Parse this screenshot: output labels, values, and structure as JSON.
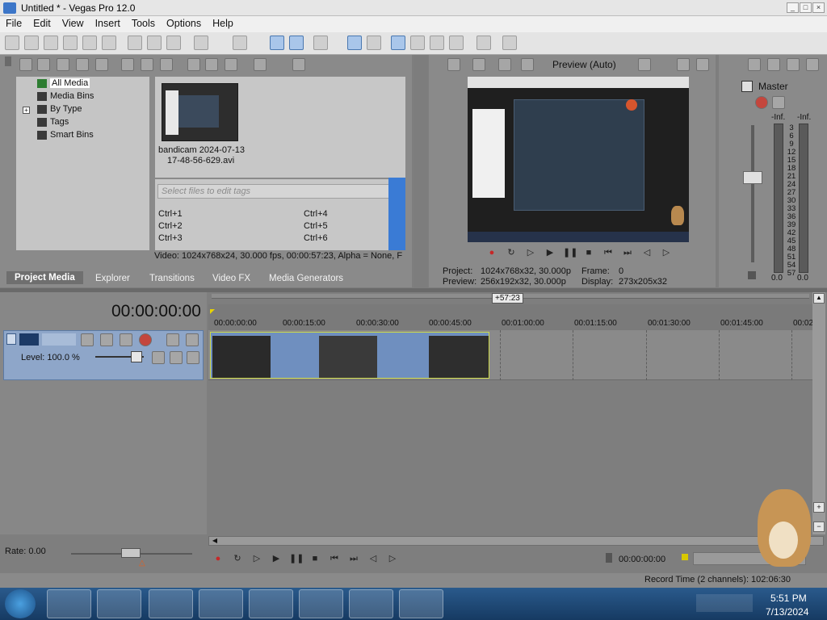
{
  "window": {
    "title": "Untitled * - Vegas Pro 12.0"
  },
  "menu": [
    "File",
    "Edit",
    "View",
    "Insert",
    "Tools",
    "Options",
    "Help"
  ],
  "explorer": {
    "tree": [
      "All Media",
      "Media Bins",
      "By Type",
      "Tags",
      "Smart Bins"
    ],
    "media_file": {
      "name_line1": "bandicam 2024-07-13",
      "name_line2": "17-48-56-629.avi"
    },
    "tags_placeholder": "Select files to edit tags",
    "shortcuts": [
      "Ctrl+1",
      "Ctrl+2",
      "Ctrl+3",
      "Ctrl+4",
      "Ctrl+5",
      "Ctrl+6"
    ],
    "file_info": "Video: 1024x768x24, 30.000 fps, 00:00:57:23, Alpha = None, F",
    "tabs": [
      "Project Media",
      "Explorer",
      "Transitions",
      "Video FX",
      "Media Generators"
    ]
  },
  "preview": {
    "mode": "Preview (Auto)",
    "project_label": "Project:",
    "project_value": "1024x768x32, 30.000p",
    "preview_label": "Preview:",
    "preview_value": "256x192x32, 30.000p",
    "frame_label": "Frame:",
    "frame_value": "0",
    "display_label": "Display:",
    "display_value": "273x205x32"
  },
  "mixer": {
    "title": "Master",
    "peak_left": "-Inf.",
    "peak_right": "-Inf.",
    "scale": [
      "3",
      "6",
      "9",
      "12",
      "15",
      "18",
      "21",
      "24",
      "27",
      "30",
      "33",
      "36",
      "39",
      "42",
      "45",
      "48",
      "51",
      "54",
      "57"
    ],
    "value_left": "0.0",
    "value_right": "0.0"
  },
  "timeline": {
    "timecode": "00:00:00:00",
    "duration_badge": "+57:23",
    "ruler": [
      "00:00:00:00",
      "00:00:15:00",
      "00:00:30:00",
      "00:00:45:00",
      "00:01:00:00",
      "00:01:15:00",
      "00:01:30:00",
      "00:01:45:00",
      "00:02"
    ],
    "track_level": "Level: 100.0 %",
    "rate": "Rate: 0.00",
    "transport_timecode": "00:00:00:00",
    "record_time": "Record Time (2 channels): 102:06:30"
  },
  "taskbar": {
    "time": "5:51 PM",
    "date": "7/13/2024"
  }
}
